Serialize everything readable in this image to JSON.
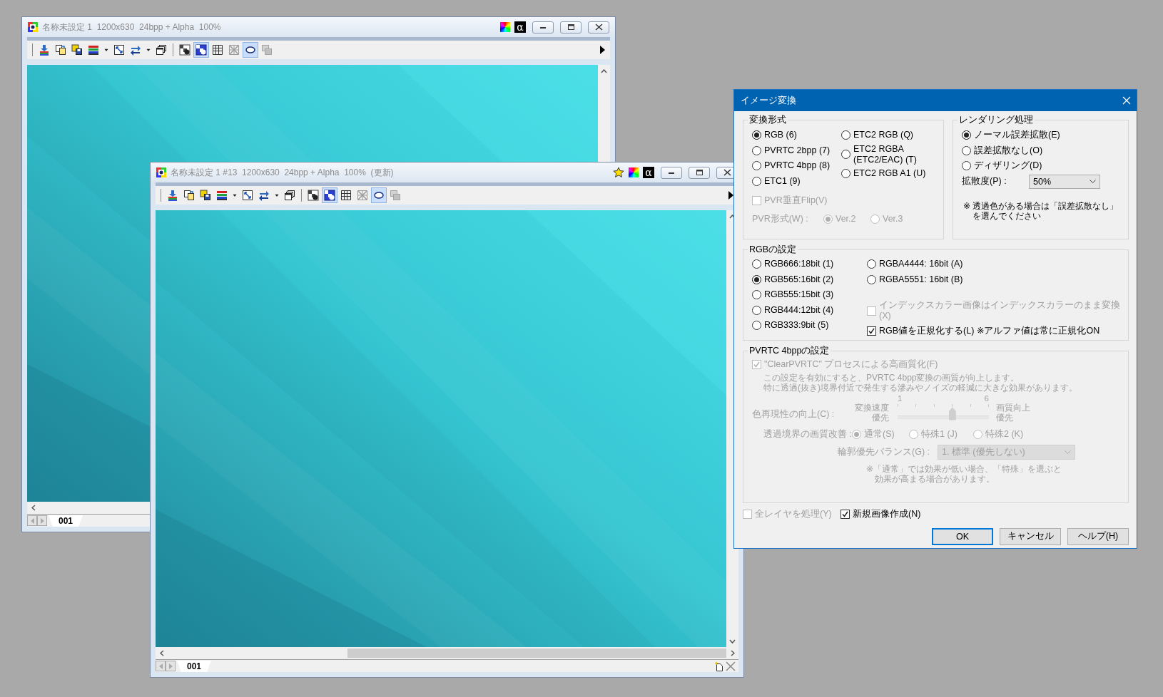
{
  "windows": [
    {
      "title": "名称未設定 1  1200x630  24bpp + Alpha  100%",
      "star": false,
      "alpha_badge": "α",
      "tab": "001",
      "toolbar": [
        [
          {
            "kind": "import",
            "pressed": false,
            "disabled": false
          },
          {
            "kind": "paste",
            "pressed": false,
            "disabled": false
          },
          {
            "kind": "save",
            "pressed": false,
            "disabled": false
          },
          {
            "kind": "layers",
            "pressed": false,
            "disabled": false
          },
          {
            "kind": "dropdown",
            "pressed": false,
            "disabled": false
          },
          {
            "kind": "fit",
            "pressed": false,
            "disabled": false
          },
          {
            "kind": "swap",
            "pressed": false,
            "disabled": false
          },
          {
            "kind": "dropdown",
            "pressed": false,
            "disabled": false
          },
          {
            "kind": "windows",
            "pressed": false,
            "disabled": false
          }
        ],
        [
          {
            "kind": "alpha",
            "pressed": false,
            "disabled": false
          },
          {
            "kind": "alpha_mask",
            "pressed": true,
            "disabled": false
          },
          {
            "kind": "grid",
            "pressed": false,
            "disabled": false
          },
          {
            "kind": "no_grid",
            "pressed": false,
            "disabled": true
          },
          {
            "kind": "ellipse",
            "pressed": true,
            "disabled": false
          },
          {
            "kind": "overlay",
            "pressed": false,
            "disabled": true
          }
        ]
      ]
    },
    {
      "title": "名称未設定 1 #13  1200x630  24bpp + Alpha  100%  (更新)",
      "star": true,
      "alpha_badge": "α",
      "tab": "001",
      "toolbar": [
        [
          {
            "kind": "import",
            "pressed": false,
            "disabled": false
          },
          {
            "kind": "paste",
            "pressed": false,
            "disabled": false
          },
          {
            "kind": "save",
            "pressed": false,
            "disabled": false
          },
          {
            "kind": "layers",
            "pressed": false,
            "disabled": false
          },
          {
            "kind": "dropdown",
            "pressed": false,
            "disabled": false
          },
          {
            "kind": "fit",
            "pressed": false,
            "disabled": false
          },
          {
            "kind": "swap",
            "pressed": false,
            "disabled": false
          },
          {
            "kind": "dropdown",
            "pressed": false,
            "disabled": false
          },
          {
            "kind": "windows",
            "pressed": false,
            "disabled": false
          }
        ],
        [
          {
            "kind": "alpha",
            "pressed": false,
            "disabled": false
          },
          {
            "kind": "alpha_mask",
            "pressed": true,
            "disabled": false
          },
          {
            "kind": "grid",
            "pressed": false,
            "disabled": false
          },
          {
            "kind": "no_grid",
            "pressed": false,
            "disabled": true
          },
          {
            "kind": "ellipse",
            "pressed": true,
            "disabled": false
          },
          {
            "kind": "overlay",
            "pressed": false,
            "disabled": true
          }
        ]
      ]
    }
  ],
  "dialog": {
    "title": "イメージ変換",
    "format": {
      "label": "変換形式",
      "options": [
        {
          "label": "RGB (6)",
          "selected": true
        },
        {
          "label": "PVRTC 2bpp (7)",
          "selected": false
        },
        {
          "label": "PVRTC 4bpp (8)",
          "selected": false
        },
        {
          "label": "ETC1 (9)",
          "selected": false
        }
      ],
      "etc2_options": [
        {
          "label": "ETC2 RGB (Q)",
          "selected": false
        },
        {
          "label": "ETC2 RGBA\n(ETC2/EAC) (T)",
          "selected": false
        },
        {
          "label": "ETC2 RGB A1 (U)",
          "selected": false
        }
      ],
      "flip": {
        "label": "PVR垂直Flip(V)",
        "checked": false,
        "disabled": true
      },
      "pvr_format": {
        "label": "PVR形式(W) :",
        "disabled": true,
        "options": [
          {
            "label": "Ver.2",
            "selected": true
          },
          {
            "label": "Ver.3",
            "selected": false
          }
        ]
      }
    },
    "rendering": {
      "label": "レンダリング処理",
      "options": [
        {
          "label": "ノーマル誤差拡散(E)",
          "selected": true
        },
        {
          "label": "誤差拡散なし(O)",
          "selected": false
        },
        {
          "label": "ディザリング(D)",
          "selected": false
        }
      ],
      "diffusion": {
        "label": "拡散度(P) :",
        "value": "50%"
      },
      "note": [
        "※ 透過色がある場合は「誤差拡散なし」",
        "を選んでください"
      ]
    },
    "rgb": {
      "label": "RGBの設定",
      "options": [
        {
          "label": "RGB666:18bit (1)",
          "selected": false
        },
        {
          "label": "RGB565:16bit (2)",
          "selected": true
        },
        {
          "label": "RGB555:15bit (3)",
          "selected": false
        },
        {
          "label": "RGB444:12bit (4)",
          "selected": false
        },
        {
          "label": "RGB333:9bit (5)",
          "selected": false
        }
      ],
      "alpha_options": [
        {
          "label": "RGBA4444: 16bit (A)",
          "selected": false
        },
        {
          "label": "RGBA5551: 16bit (B)",
          "selected": false
        }
      ],
      "index_color": {
        "label": "インデックスカラー画像はインデックスカラーのまま変換(X)",
        "checked": false,
        "disabled": true
      },
      "normalize": {
        "label": "RGB値を正規化する(L)",
        "checked": true,
        "disabled": false
      },
      "alpha_note": "※アルファ値は常に正規化ON"
    },
    "pvrtc": {
      "label": "PVRTC 4bppの設定",
      "disabled": true,
      "clear": {
        "label": "\"ClearPVRTC\" プロセスによる高画質化(F)",
        "checked": true
      },
      "description": [
        "この設定を有効にすると、PVRTC 4bpp変換の画質が向上します。",
        "特に透過(抜き)境界付近で発生する滲みやノイズの軽減に大きな効果があります。"
      ],
      "color": {
        "label": "色再現性の向上(C) :",
        "min_label": [
          "変換速度",
          "優先"
        ],
        "max_label": [
          "画質向上",
          "優先"
        ],
        "min": "1",
        "max": "6",
        "level": 0.6
      },
      "edge": {
        "label": "透過境界の画質改善 :",
        "options": [
          {
            "label": "通常(S)",
            "selected": true
          },
          {
            "label": "特殊1 (J)",
            "selected": false
          },
          {
            "label": "特殊2 (K)",
            "selected": false
          }
        ]
      },
      "balance": {
        "label": "輪郭優先バランス(G) :",
        "value": "1. 標準 (優先しない)"
      },
      "note": [
        "※「通常」では効果が低い場合、「特殊」を選ぶと",
        "効果が高まる場合があります。"
      ]
    },
    "all_layers": {
      "label": "全レイヤを処理(Y)",
      "checked": false,
      "disabled": true
    },
    "new_image": {
      "label": "新規画像作成(N)",
      "checked": true,
      "disabled": false
    },
    "buttons": [
      {
        "label": "OK",
        "default": true
      },
      {
        "label": "キャンセル",
        "default": false
      },
      {
        "label": "ヘルプ(H)",
        "default": false
      }
    ]
  }
}
